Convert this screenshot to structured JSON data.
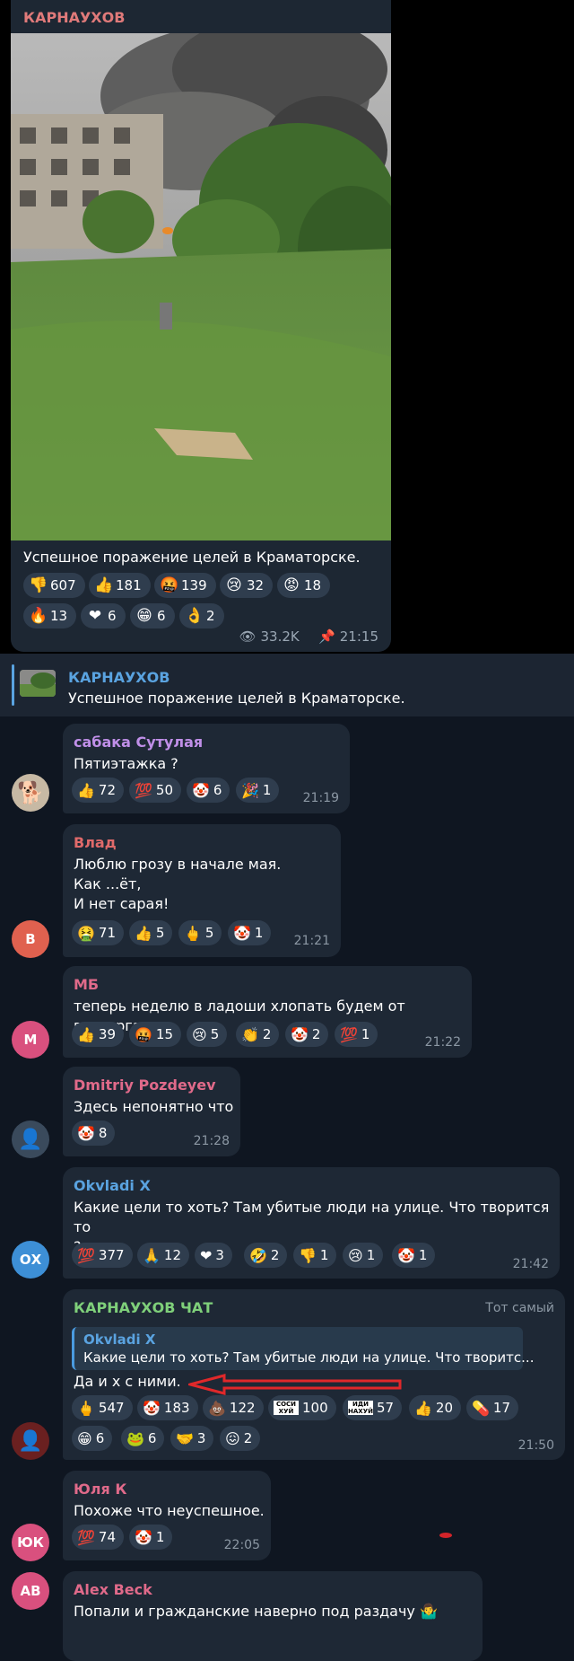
{
  "post": {
    "author": "КАРНАУХОВ",
    "text": "Успешное поражение целей в Краматорске.",
    "views": "33.2K",
    "time": "21:15",
    "reactions_row1": [
      {
        "icon": "thumbs-down",
        "glyph": "👎",
        "count": "607"
      },
      {
        "icon": "thumbs-up",
        "glyph": "👍",
        "count": "181"
      },
      {
        "icon": "cursing-face",
        "glyph": "🤬",
        "count": "139"
      },
      {
        "icon": "crying-face",
        "glyph": "😢",
        "count": "32"
      },
      {
        "icon": "angry-face",
        "glyph": "😡",
        "count": "18"
      }
    ],
    "reactions_row2": [
      {
        "icon": "fire",
        "glyph": "🔥",
        "count": "13"
      },
      {
        "icon": "heart",
        "glyph": "❤",
        "count": "6"
      },
      {
        "icon": "grin-face",
        "glyph": "😁",
        "count": "6"
      },
      {
        "icon": "ok-hand",
        "glyph": "👌",
        "count": "2"
      }
    ]
  },
  "pinned": {
    "title": "КАРНАУХОВ",
    "text": "Успешное поражение целей в Краматорске."
  },
  "messages": [
    {
      "author": "сабака Сутулая",
      "author_color": "#c08fe8",
      "text": "Пятиэтажка ?",
      "time": "21:19",
      "reactions": [
        {
          "icon": "thumbs-up",
          "glyph": "👍",
          "count": "72"
        },
        {
          "icon": "hundred",
          "glyph": "💯",
          "count": "50"
        },
        {
          "icon": "clown",
          "glyph": "🤡",
          "count": "6"
        },
        {
          "icon": "party-popper",
          "glyph": "🎉",
          "count": "1"
        }
      ]
    },
    {
      "author": "Влад",
      "author_color": "#e06a6a",
      "avatar_letter": "В",
      "text": "Люблю грозу в начале мая.\nКак  ...ёт,\nИ нет сарая!",
      "time": "21:21",
      "reactions": [
        {
          "icon": "nauseated-face",
          "glyph": "🤮",
          "count": "71"
        },
        {
          "icon": "thumbs-up",
          "glyph": "👍",
          "count": "5"
        },
        {
          "icon": "middle-finger",
          "glyph": "🖕",
          "count": "5"
        },
        {
          "icon": "clown",
          "glyph": "🤡",
          "count": "1"
        }
      ]
    },
    {
      "author": "МБ",
      "author_color": "#e06a8a",
      "avatar_letter": "М",
      "text": "теперь неделю в ладоши хлопать будем от восторга",
      "time": "21:22",
      "reactions": [
        {
          "icon": "thumbs-up",
          "glyph": "👍",
          "count": "39"
        },
        {
          "icon": "cursing-face",
          "glyph": "🤬",
          "count": "15"
        },
        {
          "icon": "crying-face",
          "glyph": "😢",
          "count": "5"
        },
        {
          "icon": "clapping",
          "glyph": "👏",
          "count": "2"
        },
        {
          "icon": "clown",
          "glyph": "🤡",
          "count": "2"
        },
        {
          "icon": "hundred",
          "glyph": "💯",
          "count": "1"
        }
      ]
    },
    {
      "author": "Dmitriy Pozdeyev",
      "author_color": "#e06a8a",
      "text": "Здесь непонятно что",
      "time": "21:28",
      "reactions": [
        {
          "icon": "clown",
          "glyph": "🤡",
          "count": "8"
        }
      ]
    },
    {
      "author": "Okvladi X",
      "author_color": "#5aa3e0",
      "avatar_letter": "ОХ",
      "text": "Какие цели то хоть? Там убитые люди на улице. Что творится то\n?",
      "time": "21:42",
      "reactions": [
        {
          "icon": "hundred",
          "glyph": "💯",
          "count": "377"
        },
        {
          "icon": "folded-hands",
          "glyph": "🙏",
          "count": "12"
        },
        {
          "icon": "heart",
          "glyph": "❤",
          "count": "3"
        },
        {
          "icon": "rofl-face",
          "glyph": "🤣",
          "count": "2"
        },
        {
          "icon": "thumbs-down",
          "glyph": "👎",
          "count": "1"
        },
        {
          "icon": "crying-face",
          "glyph": "😢",
          "count": "1"
        },
        {
          "icon": "clown",
          "glyph": "🤡",
          "count": "1"
        }
      ]
    },
    {
      "author": "КАРНАУХОВ ЧАТ",
      "author_color": "#7fd07a",
      "badge": "Тот самый",
      "quote_author": "Okvladi X",
      "quote_text": "Какие цели то хоть? Там убитые люди на улице. Что творитс...",
      "text": "Да и х с ними.",
      "time": "21:50",
      "reactions_row1": [
        {
          "icon": "middle-finger",
          "glyph": "🖕",
          "count": "547"
        },
        {
          "icon": "clown",
          "glyph": "🤡",
          "count": "183"
        },
        {
          "icon": "poop",
          "glyph": "💩",
          "count": "122"
        },
        {
          "icon": "sticker-sosi",
          "glyph": "СОСИ ХУЙ",
          "count": "100"
        },
        {
          "icon": "sticker-idi",
          "glyph": "ИДИ НАХУЙ",
          "count": "57"
        },
        {
          "icon": "thumbs-up",
          "glyph": "👍",
          "count": "20"
        },
        {
          "icon": "pill",
          "glyph": "💊",
          "count": "17"
        }
      ],
      "reactions_row2": [
        {
          "icon": "grin-face",
          "glyph": "😁",
          "count": "6"
        },
        {
          "icon": "sticker-frog",
          "glyph": "🐸",
          "count": "6"
        },
        {
          "icon": "handshake",
          "glyph": "🤝",
          "count": "3"
        },
        {
          "icon": "sticker-face",
          "glyph": "😖",
          "count": "2"
        }
      ]
    },
    {
      "author": "Юля К",
      "author_color": "#e06a8a",
      "avatar_letter": "ЮК",
      "text": "Похоже что неуспешное.",
      "time": "22:05",
      "reactions": [
        {
          "icon": "hundred",
          "glyph": "💯",
          "count": "74"
        },
        {
          "icon": "clown",
          "glyph": "🤡",
          "count": "1"
        }
      ]
    },
    {
      "author": "Alex Beck",
      "author_color": "#e06a8a",
      "avatar_letter": "AB",
      "text": "Попали и гражданские наверно под раздачу 🤷‍♂️"
    }
  ]
}
